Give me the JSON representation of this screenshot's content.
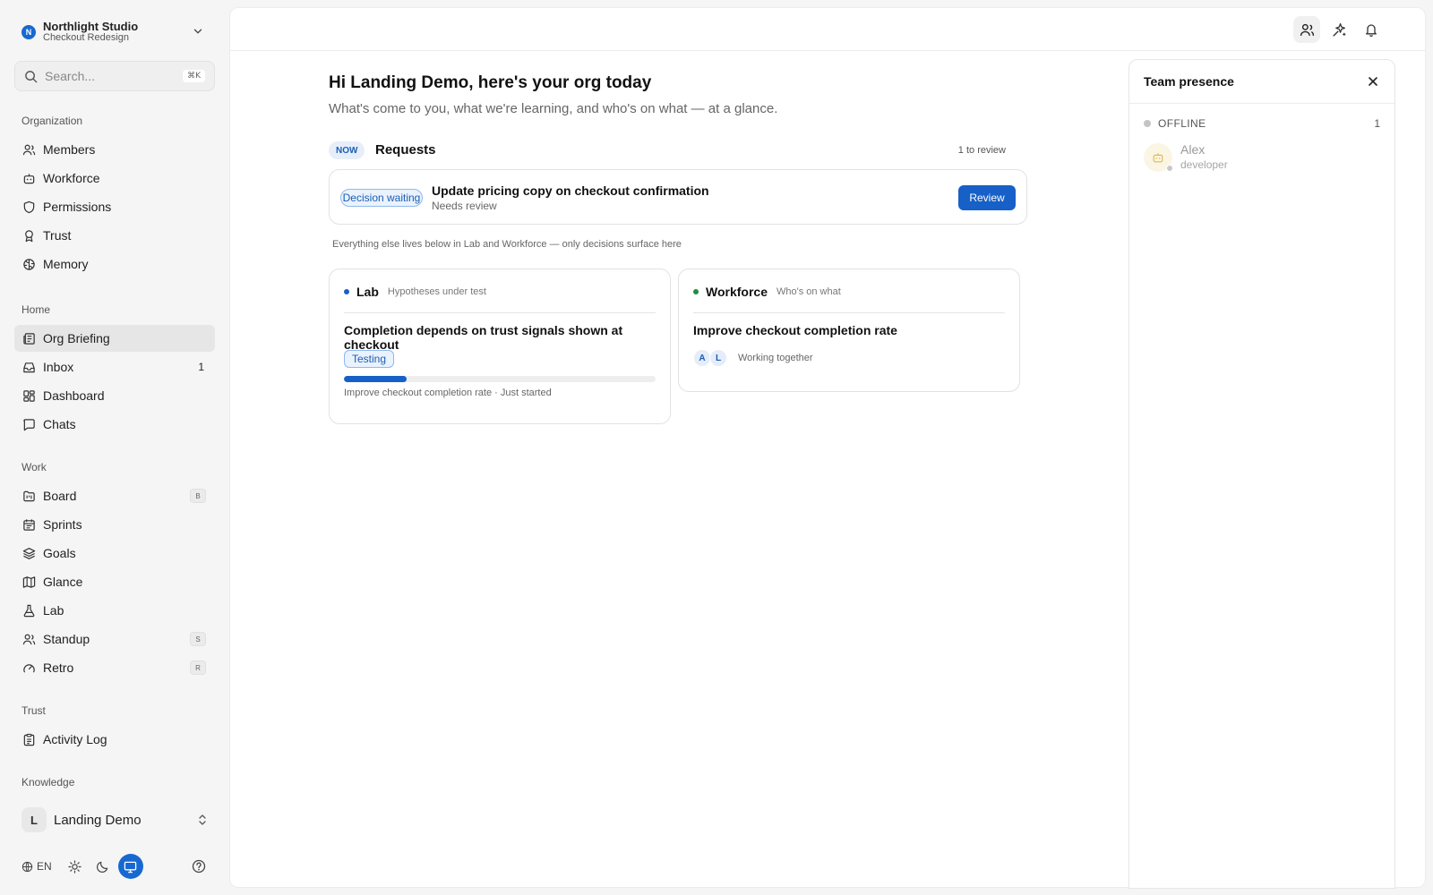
{
  "org": {
    "name": "Northlight Studio",
    "project": "Checkout Redesign",
    "logo_letter": "N"
  },
  "search": {
    "placeholder": "Search...",
    "shortcut": "⌘K"
  },
  "sidebar": {
    "sections": [
      {
        "label": "Organization",
        "items": [
          {
            "label": "Members",
            "icon": "users-icon"
          },
          {
            "label": "Workforce",
            "icon": "bot-icon"
          },
          {
            "label": "Permissions",
            "icon": "shield-icon"
          },
          {
            "label": "Trust",
            "icon": "award-icon"
          },
          {
            "label": "Memory",
            "icon": "brain-icon"
          }
        ]
      },
      {
        "label": "Home",
        "items": [
          {
            "label": "Org Briefing",
            "icon": "newspaper-icon",
            "active": true
          },
          {
            "label": "Inbox",
            "icon": "inbox-icon",
            "count": "1"
          },
          {
            "label": "Dashboard",
            "icon": "dashboard-icon"
          },
          {
            "label": "Chats",
            "icon": "chat-icon"
          }
        ]
      },
      {
        "label": "Work",
        "items": [
          {
            "label": "Board",
            "icon": "board-icon",
            "key": "B"
          },
          {
            "label": "Sprints",
            "icon": "calendar-icon"
          },
          {
            "label": "Goals",
            "icon": "layers-icon"
          },
          {
            "label": "Glance",
            "icon": "map-icon"
          },
          {
            "label": "Lab",
            "icon": "flask-icon"
          },
          {
            "label": "Standup",
            "icon": "users-icon",
            "key": "S"
          },
          {
            "label": "Retro",
            "icon": "gauge-icon",
            "key": "R"
          }
        ]
      },
      {
        "label": "Trust",
        "items": [
          {
            "label": "Activity Log",
            "icon": "clipboard-icon"
          }
        ]
      },
      {
        "label": "Knowledge",
        "items": []
      }
    ]
  },
  "user": {
    "initial": "L",
    "name": "Landing Demo"
  },
  "footer": {
    "language": "EN"
  },
  "greeting": {
    "title": "Hi Landing Demo, here's your org today",
    "subtitle": "What's come to you, what we're learning, and who's on what — at a glance."
  },
  "requests": {
    "badge": "NOW",
    "title": "Requests",
    "count": "1 to review",
    "item": {
      "chip": "Decision waiting",
      "title": "Update pricing copy on checkout confirmation",
      "status": "Needs review",
      "button": "Review"
    },
    "note": "Everything else lives below in Lab and Workforce — only decisions surface here"
  },
  "lab": {
    "name": "Lab",
    "tag": "Hypotheses under test",
    "hypothesis": "Completion depends on trust signals shown at checkout",
    "status": "Testing",
    "progress": 0.2,
    "footer": "Improve checkout completion rate · Just started"
  },
  "workforce": {
    "name": "Workforce",
    "tag": "Who's on what",
    "goal": "Improve checkout completion rate",
    "members": [
      "A",
      "L"
    ],
    "note": "Working together"
  },
  "presence": {
    "title": "Team presence",
    "status": "OFFLINE",
    "count": "1",
    "person": {
      "name": "Alex",
      "role": "developer"
    }
  },
  "colors": {
    "accent": "#1660c7",
    "lab_dot": "#1660c7",
    "workforce_dot": "#1e8f3c"
  }
}
